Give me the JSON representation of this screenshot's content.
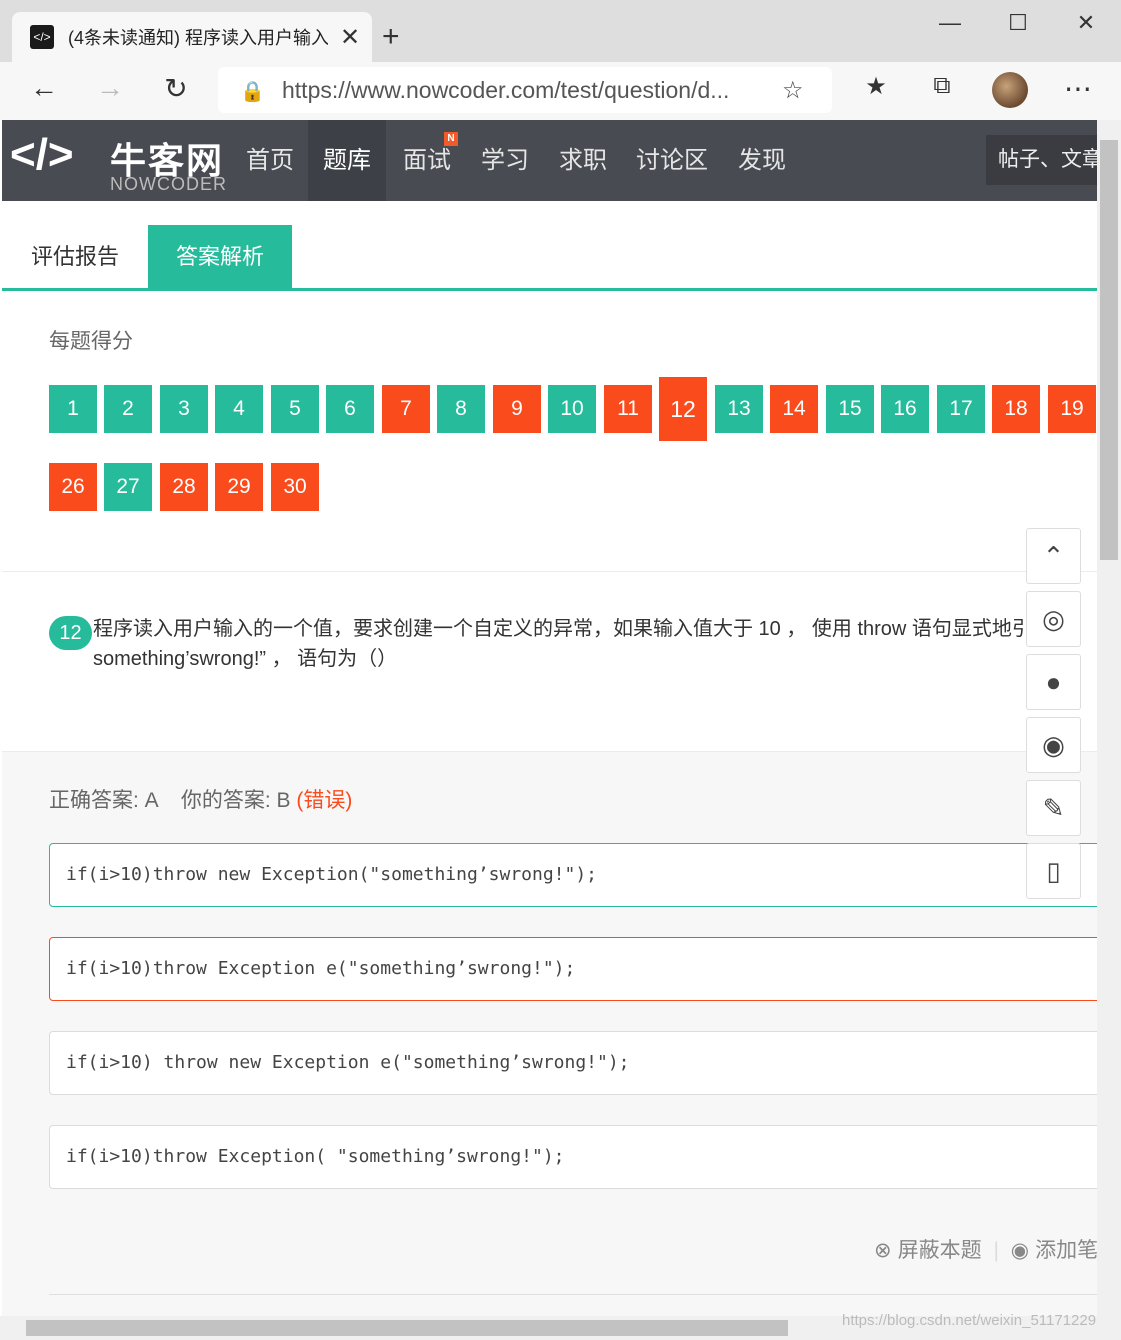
{
  "browser": {
    "tab_title": "(4条未读通知) 程序读入用户输入",
    "tab_close": "✕",
    "new_tab": "+",
    "url": "https://www.nowcoder.com/test/question/d...",
    "win_min": "—",
    "win_max": "☐",
    "win_close": "✕"
  },
  "site": {
    "logo_cn": "牛客网",
    "logo_en": "NOWCODER",
    "nav": [
      "首页",
      "题库",
      "面试",
      "学习",
      "求职",
      "讨论区",
      "发现"
    ],
    "nav_badge": "N",
    "search_placeholder": "帖子、文章"
  },
  "tabs": {
    "report": "评估报告",
    "answer": "答案解析"
  },
  "score": {
    "title": "每题得分",
    "row1": [
      {
        "n": "1",
        "s": "g"
      },
      {
        "n": "2",
        "s": "g"
      },
      {
        "n": "3",
        "s": "g"
      },
      {
        "n": "4",
        "s": "g"
      },
      {
        "n": "5",
        "s": "g"
      },
      {
        "n": "6",
        "s": "g"
      },
      {
        "n": "7",
        "s": "r"
      },
      {
        "n": "8",
        "s": "g"
      },
      {
        "n": "9",
        "s": "r"
      },
      {
        "n": "10",
        "s": "g"
      },
      {
        "n": "11",
        "s": "r"
      },
      {
        "n": "12",
        "s": "r"
      },
      {
        "n": "13",
        "s": "g"
      },
      {
        "n": "14",
        "s": "r"
      },
      {
        "n": "15",
        "s": "g"
      },
      {
        "n": "16",
        "s": "g"
      },
      {
        "n": "17",
        "s": "g"
      },
      {
        "n": "18",
        "s": "r"
      },
      {
        "n": "19",
        "s": "r"
      }
    ],
    "row2": [
      {
        "n": "26",
        "s": "r"
      },
      {
        "n": "27",
        "s": "g"
      },
      {
        "n": "28",
        "s": "r"
      },
      {
        "n": "29",
        "s": "r"
      },
      {
        "n": "30",
        "s": "r"
      }
    ],
    "current": "12"
  },
  "question": {
    "number": "12",
    "line1": "程序读入用户输入的一个值，要求创建一个自定义的异常，如果输入值大于 10 ， 使用 throw 语句显式地引发",
    "line2": "something’swrong!” ， 语句为（）"
  },
  "answer": {
    "correct_label": "正确答案: A",
    "yours_label": "你的答案: B",
    "status": "(错误)"
  },
  "options": [
    "if(i>10)throw new Exception(\"something’swrong!\");",
    "if(i>10)throw Exception e(\"something’swrong!\");",
    "if(i>10) throw new Exception e(\"something’swrong!\");",
    "if(i>10)throw Exception( \"something’swrong!\");"
  ],
  "actions": {
    "hide": "屏蔽本题",
    "note": "添加笔记"
  },
  "watermark": "https://blog.csdn.net/weixin_51171229"
}
